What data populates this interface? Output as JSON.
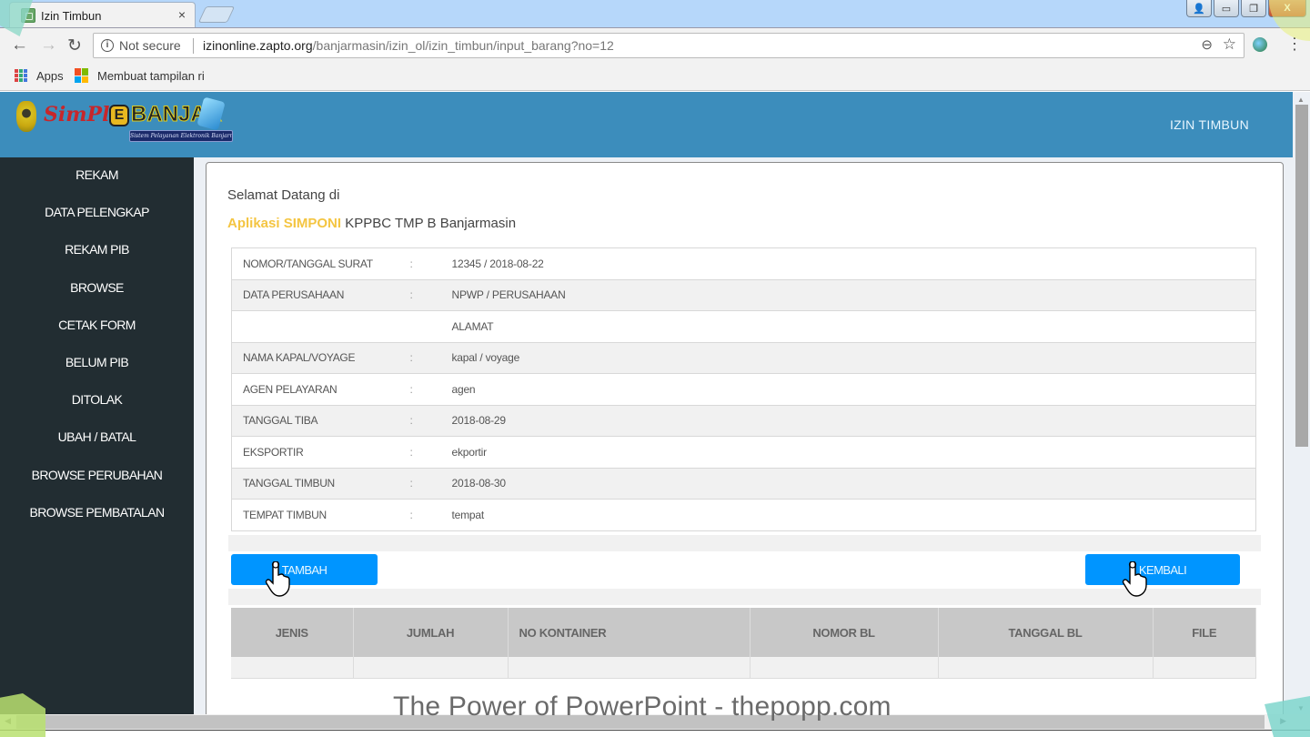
{
  "browser": {
    "tab_title": "Izin Timbun",
    "tab_close": "×",
    "security_label": "Not secure",
    "url_host": "izinonline.zapto.org",
    "url_path": "/banjarmasin/izin_ol/izin_timbun/input_barang?no=12",
    "nav": {
      "back": "←",
      "forward": "→",
      "reload": "↻"
    },
    "bookmarks": [
      {
        "label": "Apps"
      },
      {
        "label": "Membuat tampilan ri"
      }
    ],
    "window_controls": {
      "user": "👤",
      "minimize": "▭",
      "restore": "❐",
      "close": "X"
    }
  },
  "header": {
    "logo_sim": "SimPl",
    "logo_e": "E",
    "logo_banjar": "BANJAR",
    "logo_tagline": "Sistem Pelayanan Elektronik Banjarmasin",
    "title": "IZIN TIMBUN",
    "header_color": "#3c8dbc"
  },
  "sidebar": {
    "items": [
      {
        "label": "REKAM"
      },
      {
        "label": "DATA PELENGKAP"
      },
      {
        "label": "REKAM PIB"
      },
      {
        "label": "BROWSE"
      },
      {
        "label": "CETAK FORM"
      },
      {
        "label": "BELUM PIB"
      },
      {
        "label": "DITOLAK"
      },
      {
        "label": "UBAH / BATAL"
      },
      {
        "label": "BROWSE PERUBAHAN"
      },
      {
        "label": "BROWSE PEMBATALAN"
      }
    ]
  },
  "main": {
    "welcome": "Selamat Datang di",
    "app_name": "Aplikasi SIMPONI",
    "app_office": " KPPBC TMP B Banjarmasin",
    "accent_color": "#f4c542",
    "info_rows": [
      {
        "label": "NOMOR/TANGGAL SURAT",
        "colon": ":",
        "value": "12345 / 2018-08-22"
      },
      {
        "label": "DATA PERUSAHAAN",
        "colon": ":",
        "value": "NPWP / PERUSAHAAN"
      },
      {
        "label": "",
        "colon": "",
        "value": "ALAMAT"
      },
      {
        "label": "NAMA KAPAL/VOYAGE",
        "colon": ":",
        "value": "kapal / voyage"
      },
      {
        "label": "AGEN PELAYARAN",
        "colon": ":",
        "value": "agen"
      },
      {
        "label": "TANGGAL TIBA",
        "colon": ":",
        "value": "2018-08-29"
      },
      {
        "label": "EKSPORTIR",
        "colon": ":",
        "value": "ekportir"
      },
      {
        "label": "TANGGAL TIMBUN",
        "colon": ":",
        "value": "2018-08-30"
      },
      {
        "label": "TEMPAT TIMBUN",
        "colon": ":",
        "value": "tempat"
      }
    ],
    "buttons": {
      "add": "TAMBAH",
      "back": "KEMBALI",
      "button_color": "#0095ff"
    },
    "goods_table": {
      "columns": [
        "JENIS",
        "JUMLAH",
        "NO KONTAINER",
        "NOMOR BL",
        "TANGGAL BL",
        "FILE"
      ],
      "rows": [
        [
          "",
          "",
          "",
          "",
          "",
          ""
        ]
      ]
    }
  },
  "overlay": {
    "watermark": "The Power of PowerPoint - thepopp.com"
  }
}
